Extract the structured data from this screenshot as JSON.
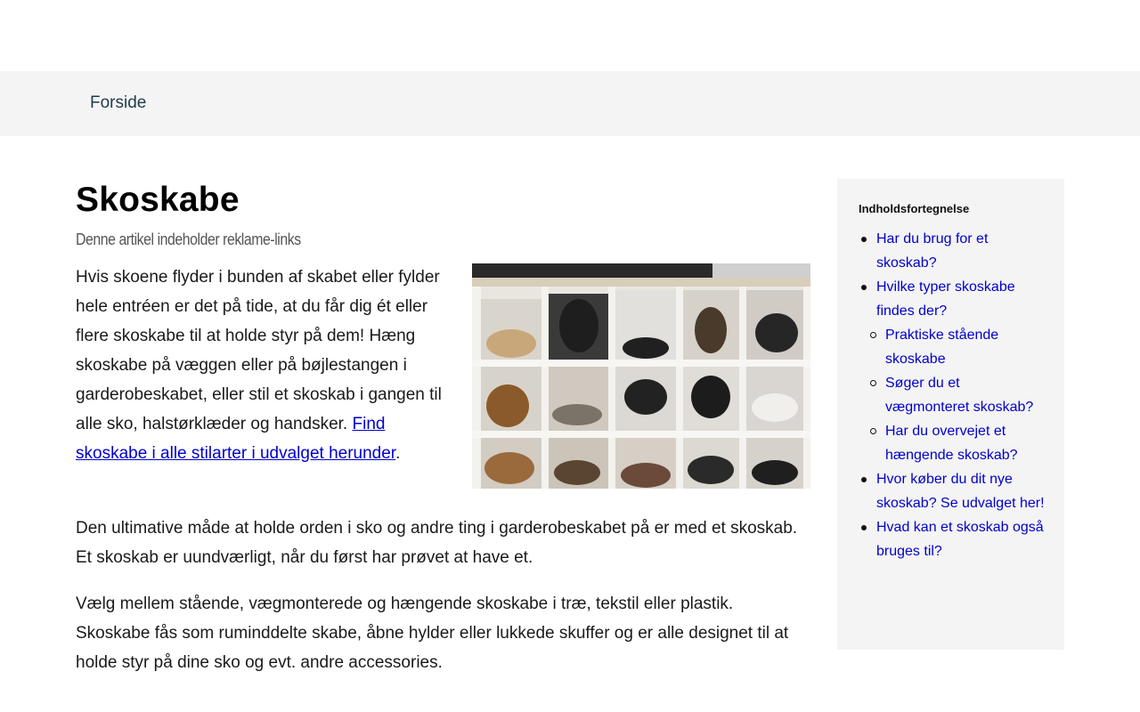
{
  "nav": {
    "home_label": "Forside"
  },
  "article": {
    "title": "Skoskabe",
    "disclaimer": "Denne artikel indeholder reklame-links",
    "intro_text": "Hvis skoene flyder i bunden af skabet eller fylder hele entréen er det på tide, at du får dig ét eller flere skoskabe til at holde styr på dem! Hæng skoskabe på væggen eller på bøjlestangen i garderobeskabet, eller stil et skoskab i gangen til alle sko, halstørklæder og handsker.",
    "intro_link": "Find skoskabe i alle stilarter i udvalget herunder",
    "intro_end": ".",
    "image_icon": "shoe-cabinet-photo",
    "paragraph_2": "Den ultimative måde at holde orden i sko og andre ting i garderobeskabet på er med et skoskab. Et skoskab er uundværligt, når du først har prøvet at have et.",
    "paragraph_3": "Vælg mellem stående, vægmonterede og hængende skoskabe i træ, tekstil eller plastik. Skoskabe fås som ruminddelte skabe, åbne hylder eller lukkede skuffer og er alle designet til at holde styr på dine sko og evt. andre accessories."
  },
  "toc": {
    "title": "Indholdsfortegnelse",
    "items": [
      {
        "label": "Har du brug for et skoskab?",
        "level": 1
      },
      {
        "label": "Hvilke typer skoskabe findes der?",
        "level": 1
      },
      {
        "label": "Praktiske stående skoskabe",
        "level": 2
      },
      {
        "label": "Søger du et vægmonteret skoskab?",
        "level": 2
      },
      {
        "label": "Har du overvejet et hængende skoskab?",
        "level": 2
      },
      {
        "label": "Hvor køber du dit nye skoskab? Se udvalget her!",
        "level": 1
      },
      {
        "label": "Hvad kan et skoskab også bruges til?",
        "level": 1
      }
    ]
  },
  "colors": {
    "link": "#0000cc",
    "nav_background": "#f4f4f4",
    "toc_background": "#f4f4f4"
  }
}
